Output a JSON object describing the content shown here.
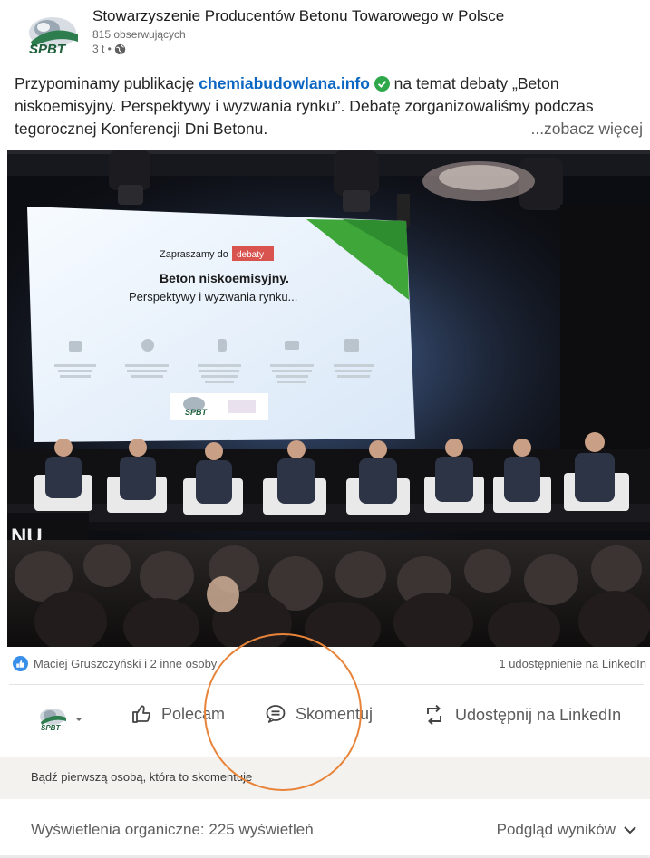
{
  "header": {
    "org_name": "Stowarzyszenie Producentów Betonu Towarowego w Polsce",
    "followers": "815 obserwujących",
    "age": "3 t •",
    "logo_text": "SPBT"
  },
  "post": {
    "text_1": "Przypominamy publikację ",
    "link": "chemiabudowlana.info",
    "text_2": " na temat debaty „Beton niskoemisyjny. Perspektywy i wyzwania rynku”. Debatę zorganizowaliśmy podczas tegorocznej Konferencji Dni Betonu.",
    "see_more": "...zobacz więcej"
  },
  "photo": {
    "slide_intro": "Zapraszamy do",
    "slide_badge": "debaty",
    "slide_title": "Beton niskoemisyjny.",
    "slide_subtitle": "Perspektywy i wyzwania rynku...",
    "slide_logo": "SPBT",
    "podium_text": "NU"
  },
  "reactions": {
    "left": "Maciej Gruszczyński i 2 inne osoby",
    "right": "1 udostępnienie na LinkedIn"
  },
  "actions": {
    "recommend": "Polecam",
    "comment": "Skomentuj",
    "share": "Udostępnij na LinkedIn"
  },
  "comment_prompt": "Bądź pierwszą osobą, która to skomentuje",
  "stats": {
    "impressions": "Wyświetlenia organiczne: 225 wyświetleń",
    "preview": "Podgląd wyników"
  },
  "colors": {
    "link": "#0a66c2",
    "annotation_circle": "#e8843a",
    "badge_red": "#d9534f",
    "slide_green": "#3fa63a"
  }
}
